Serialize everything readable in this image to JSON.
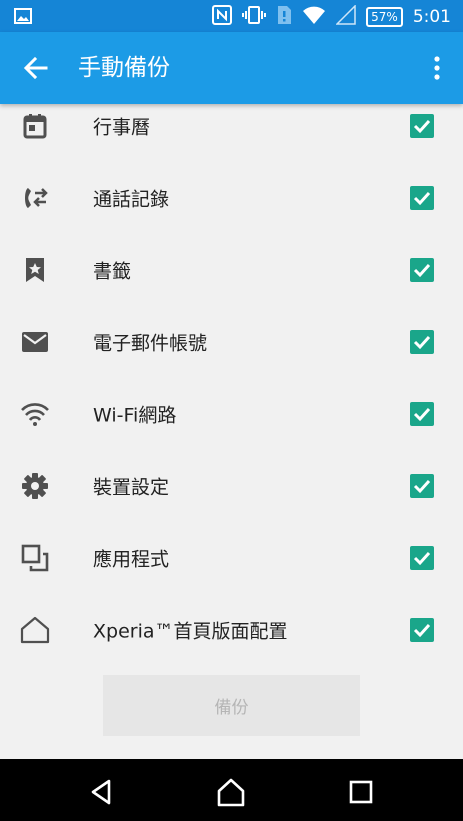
{
  "status_bar": {
    "battery": "57%",
    "time": "5:01"
  },
  "app_bar": {
    "title": "手動備份"
  },
  "items": [
    {
      "label": "行事曆",
      "icon": "calendar-icon",
      "checked": true
    },
    {
      "label": "通話記錄",
      "icon": "call-log-icon",
      "checked": true
    },
    {
      "label": "書籤",
      "icon": "bookmark-icon",
      "checked": true
    },
    {
      "label": "電子郵件帳號",
      "icon": "email-icon",
      "checked": true
    },
    {
      "label": "Wi-Fi網路",
      "icon": "wifi-icon",
      "checked": true
    },
    {
      "label": "裝置設定",
      "icon": "settings-gear-icon",
      "checked": true
    },
    {
      "label": "應用程式",
      "icon": "apps-icon",
      "checked": true
    },
    {
      "label": "Xperia™首頁版面配置",
      "icon": "home-icon",
      "checked": true
    }
  ],
  "backup_button": {
    "label": "備份"
  },
  "colors": {
    "status_bar": "#1585d6",
    "app_bar": "#1c9be6",
    "checkbox": "#1aa68a",
    "background": "#f1f1f1"
  }
}
